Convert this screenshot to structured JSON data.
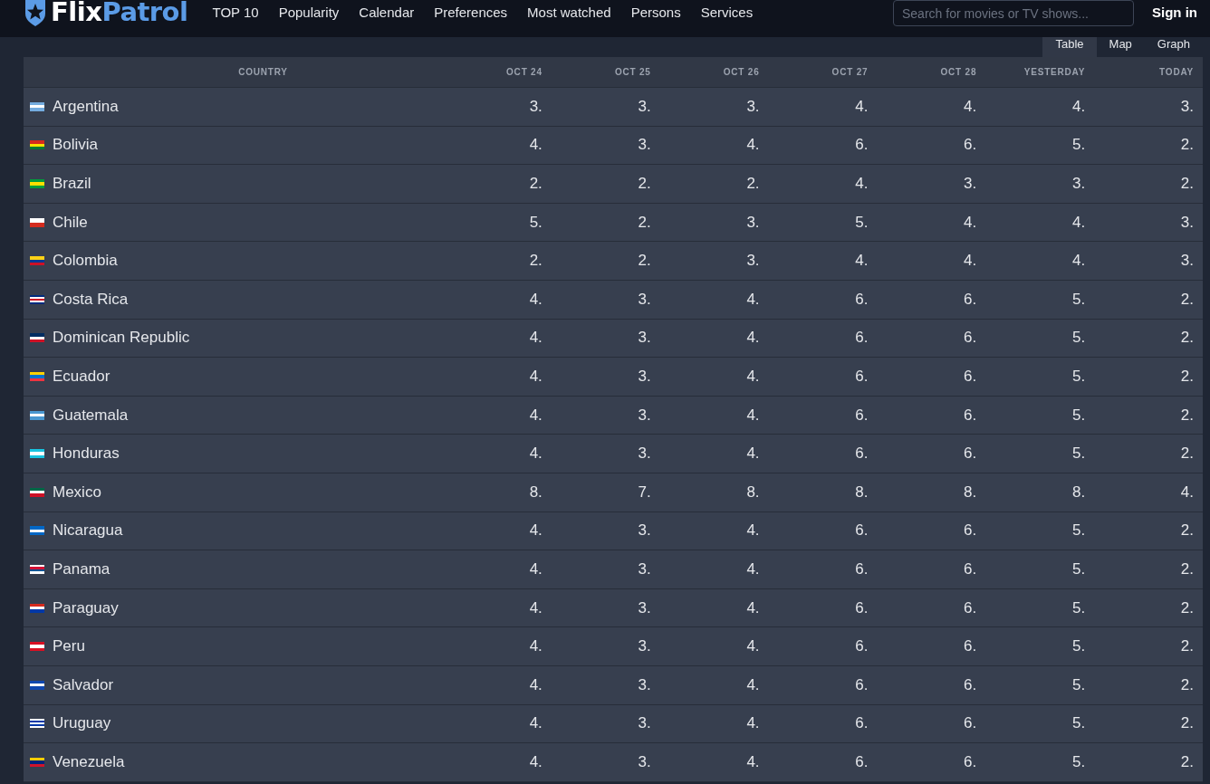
{
  "header": {
    "logo": {
      "part_1": "Flix",
      "part_2": "Patrol"
    },
    "nav": [
      "TOP 10",
      "Popularity",
      "Calendar",
      "Preferences",
      "Most watched",
      "Persons",
      "Services"
    ],
    "search": {
      "placeholder": "Search for movies or TV shows..."
    },
    "sign_in": "Sign in"
  },
  "view_tabs": [
    {
      "label": "Table",
      "selected": true
    },
    {
      "label": "Map",
      "selected": false
    },
    {
      "label": "Graph",
      "selected": false
    }
  ],
  "table": {
    "columns": [
      "COUNTRY",
      "OCT 24",
      "OCT 25",
      "OCT 26",
      "OCT 27",
      "OCT 28",
      "YESTERDAY",
      "TODAY"
    ],
    "rows": [
      {
        "flag_stripes": [
          {
            "color": "#74acdf"
          },
          {
            "color": "#ffffff"
          },
          {
            "color": "#74acdf"
          }
        ],
        "cells": [
          "Argentina",
          "3.",
          "3.",
          "3.",
          "4.",
          "4.",
          "4.",
          "3."
        ]
      },
      {
        "flag_stripes": [
          {
            "color": "#d52b1e"
          },
          {
            "color": "#f9e300"
          },
          {
            "color": "#007934"
          }
        ],
        "cells": [
          "Bolivia",
          "4.",
          "3.",
          "4.",
          "6.",
          "6.",
          "5.",
          "2."
        ]
      },
      {
        "flag_stripes": [
          {
            "color": "#009c3b"
          },
          {
            "color": "#ffdf00"
          },
          {
            "color": "#009c3b"
          }
        ],
        "cells": [
          "Brazil",
          "2.",
          "2.",
          "2.",
          "4.",
          "3.",
          "3.",
          "2."
        ]
      },
      {
        "flag_stripes": [
          {
            "color": "#ffffff"
          },
          {
            "color": "#d52b1e"
          }
        ],
        "cells": [
          "Chile",
          "5.",
          "2.",
          "3.",
          "5.",
          "4.",
          "4.",
          "3."
        ]
      },
      {
        "flag_stripes": [
          {
            "color": "#fcd116"
          },
          {
            "color": "#003893"
          },
          {
            "color": "#ce1126"
          }
        ],
        "cells": [
          "Colombia",
          "2.",
          "2.",
          "3.",
          "4.",
          "4.",
          "4.",
          "3."
        ]
      },
      {
        "flag_stripes": [
          {
            "color": "#002b7f"
          },
          {
            "color": "#ffffff"
          },
          {
            "color": "#ce1126"
          },
          {
            "color": "#ffffff"
          },
          {
            "color": "#002b7f"
          }
        ],
        "cells": [
          "Costa Rica",
          "4.",
          "3.",
          "4.",
          "6.",
          "6.",
          "5.",
          "2."
        ]
      },
      {
        "flag_stripes": [
          {
            "color": "#002d62"
          },
          {
            "color": "#ffffff"
          },
          {
            "color": "#ce1126"
          }
        ],
        "cells": [
          "Dominican Republic",
          "4.",
          "3.",
          "4.",
          "6.",
          "6.",
          "5.",
          "2."
        ]
      },
      {
        "flag_stripes": [
          {
            "color": "#ffd100"
          },
          {
            "color": "#0072ce"
          },
          {
            "color": "#ef3340"
          }
        ],
        "cells": [
          "Ecuador",
          "4.",
          "3.",
          "4.",
          "6.",
          "6.",
          "5.",
          "2."
        ]
      },
      {
        "flag_stripes": [
          {
            "color": "#4997d0"
          },
          {
            "color": "#ffffff"
          },
          {
            "color": "#4997d0"
          }
        ],
        "cells": [
          "Guatemala",
          "4.",
          "3.",
          "4.",
          "6.",
          "6.",
          "5.",
          "2."
        ]
      },
      {
        "flag_stripes": [
          {
            "color": "#18c3df"
          },
          {
            "color": "#ffffff"
          },
          {
            "color": "#18c3df"
          }
        ],
        "cells": [
          "Honduras",
          "4.",
          "3.",
          "4.",
          "6.",
          "6.",
          "5.",
          "2."
        ]
      },
      {
        "flag_stripes": [
          {
            "color": "#006847"
          },
          {
            "color": "#ffffff"
          },
          {
            "color": "#ce1126"
          }
        ],
        "cells": [
          "Mexico",
          "8.",
          "7.",
          "8.",
          "8.",
          "8.",
          "8.",
          "4."
        ]
      },
      {
        "flag_stripes": [
          {
            "color": "#0067c6"
          },
          {
            "color": "#ffffff"
          },
          {
            "color": "#0067c6"
          }
        ],
        "cells": [
          "Nicaragua",
          "4.",
          "3.",
          "4.",
          "6.",
          "6.",
          "5.",
          "2."
        ]
      },
      {
        "flag_stripes": [
          {
            "color": "#ffffff"
          },
          {
            "color": "#d21034"
          },
          {
            "color": "#005293"
          },
          {
            "color": "#ffffff"
          }
        ],
        "cells": [
          "Panama",
          "4.",
          "3.",
          "4.",
          "6.",
          "6.",
          "5.",
          "2."
        ]
      },
      {
        "flag_stripes": [
          {
            "color": "#d52b1e"
          },
          {
            "color": "#ffffff"
          },
          {
            "color": "#0038a8"
          }
        ],
        "cells": [
          "Paraguay",
          "4.",
          "3.",
          "4.",
          "6.",
          "6.",
          "5.",
          "2."
        ]
      },
      {
        "flag_stripes": [
          {
            "color": "#d91023"
          },
          {
            "color": "#ffffff"
          },
          {
            "color": "#d91023"
          }
        ],
        "cells": [
          "Peru",
          "4.",
          "3.",
          "4.",
          "6.",
          "6.",
          "5.",
          "2."
        ]
      },
      {
        "flag_stripes": [
          {
            "color": "#0f47af"
          },
          {
            "color": "#ffffff"
          },
          {
            "color": "#0f47af"
          }
        ],
        "cells": [
          "Salvador",
          "4.",
          "3.",
          "4.",
          "6.",
          "6.",
          "5.",
          "2."
        ]
      },
      {
        "flag_stripes": [
          {
            "color": "#ffffff"
          },
          {
            "color": "#0038a8"
          },
          {
            "color": "#ffffff"
          },
          {
            "color": "#0038a8"
          },
          {
            "color": "#ffffff"
          }
        ],
        "cells": [
          "Uruguay",
          "4.",
          "3.",
          "4.",
          "6.",
          "6.",
          "5.",
          "2."
        ]
      },
      {
        "flag_stripes": [
          {
            "color": "#ffcc00"
          },
          {
            "color": "#00247d"
          },
          {
            "color": "#cf142b"
          }
        ],
        "cells": [
          "Venezuela",
          "4.",
          "3.",
          "4.",
          "6.",
          "6.",
          "5.",
          "2."
        ]
      }
    ]
  }
}
